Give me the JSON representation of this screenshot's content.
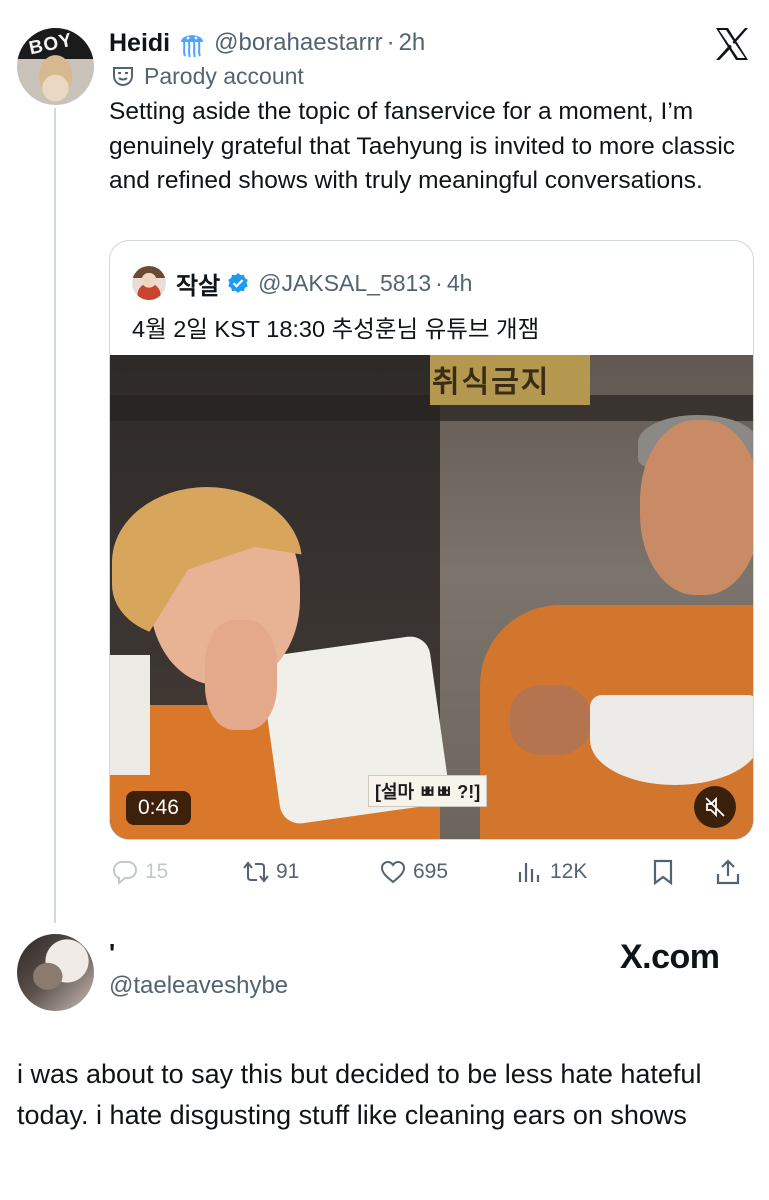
{
  "tweet": {
    "author_name": "Heidi",
    "author_handle": "@borahaestarrr",
    "separator": "·",
    "timestamp": "2h",
    "label": "Parody account",
    "avatar_text": "BOY",
    "text": "Setting aside the topic of fanservice for a moment, I’m genuinely grateful that Taehyung is invited to more classic and refined shows with truly meaningful conversations."
  },
  "quote": {
    "author_name": "작살",
    "author_handle": "@JAKSAL_5813",
    "separator": "·",
    "timestamp": "4h",
    "text": "4월 2일 KST 18:30 추성훈님 유튜브 개잼",
    "video": {
      "duration": "0:46",
      "subtitle": "[설마 ㅃㅃ ?!]",
      "sign_text": "취식금지"
    }
  },
  "actions": {
    "replies": "15",
    "reposts": "91",
    "likes": "695",
    "views": "12K"
  },
  "reply": {
    "author_name": "'",
    "author_handle": "@taeleaveshybe",
    "watermark": "X.com",
    "text": "i was about to say this but decided to be less hate hateful today. i hate disgusting stuff like cleaning ears on shows"
  },
  "colors": {
    "text": "#0f1419",
    "secondary": "#536471",
    "border": "#cfd9de",
    "verified": "#1d9bf0"
  },
  "icons": [
    "jellyfish-emoji-icon",
    "x-logo-icon",
    "parody-mask-icon",
    "verified-badge-icon",
    "mute-icon",
    "reply-icon",
    "repost-icon",
    "like-icon",
    "views-icon",
    "bookmark-icon",
    "share-icon"
  ]
}
